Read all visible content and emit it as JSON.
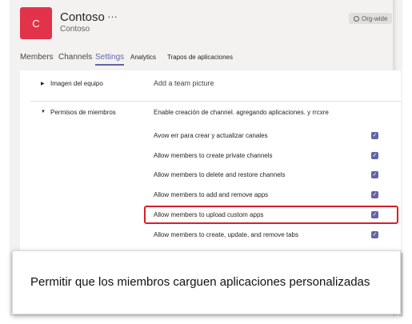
{
  "team": {
    "avatar_letter": "C",
    "name": "Contoso",
    "subtitle": "Contoso",
    "more_icon": "…",
    "badge": "Org-wide",
    "badge_icon": "globe-icon"
  },
  "tabs": [
    {
      "label": "Members"
    },
    {
      "label": "Channels"
    },
    {
      "label": "Settings",
      "active": true
    },
    {
      "label": "Analytics"
    },
    {
      "label": "Trapos de aplicaciones"
    }
  ],
  "settings": {
    "team_picture": {
      "title": "Imagen del equipo",
      "value": "Add a team picture"
    },
    "member_permissions": {
      "title": "Permisos de miembros",
      "intro_prefix": "Enable",
      "intro": "creación de channel. agregando aplicaciones. y rrcxre",
      "items": [
        {
          "label": "Avow err para crear y actualizar canales",
          "checked": true
        },
        {
          "label": "Allow members to create private channels",
          "checked": true
        },
        {
          "label": "Allow members to delete and restore channels",
          "checked": true
        },
        {
          "label": "Allow members to add and remove apps",
          "checked": true
        },
        {
          "label": "Allow members to upload custom apps",
          "checked": true
        },
        {
          "label": "Allow members to create, update, and remove tabs",
          "checked": true
        }
      ]
    }
  },
  "callout": {
    "text": "Permitir que los miembros carguen aplicaciones personalizadas"
  },
  "colors": {
    "accent": "#6264a7",
    "avatar": "#e2334a",
    "highlight": "#d81e2c"
  }
}
